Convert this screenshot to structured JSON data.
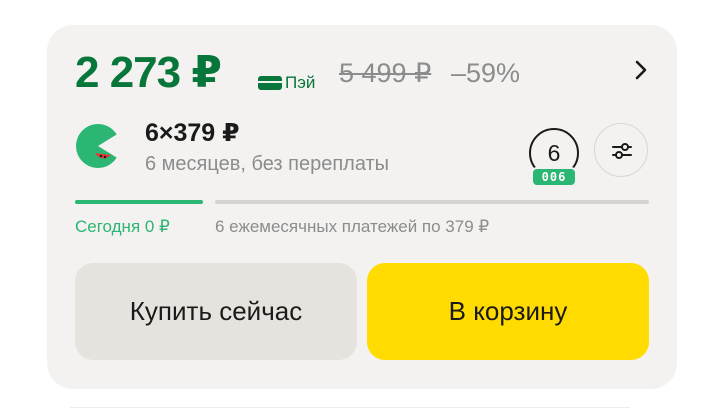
{
  "price": {
    "current": "2 273 ₽",
    "pay_label": "Пэй",
    "old": "5 499 ₽",
    "discount": "–59%"
  },
  "split": {
    "amount": "6×379 ₽",
    "description": "6 месяцев, без переплаты",
    "months": "6",
    "badge": "006"
  },
  "schedule": {
    "today": "Сегодня 0 ₽",
    "monthly": "6 ежемесячных платежей по 379 ₽"
  },
  "actions": {
    "buy_now": "Купить сейчас",
    "add_to_cart": "В корзину"
  },
  "colors": {
    "price_green": "#07763b",
    "accent_green": "#2bb673",
    "cart_yellow": "#ffdb00",
    "card_bg": "#f3f2f0"
  },
  "icons": {
    "pay": "card-icon",
    "next": "chevron-right-icon",
    "split_logo": "split-logo-icon",
    "settings": "sliders-icon"
  }
}
